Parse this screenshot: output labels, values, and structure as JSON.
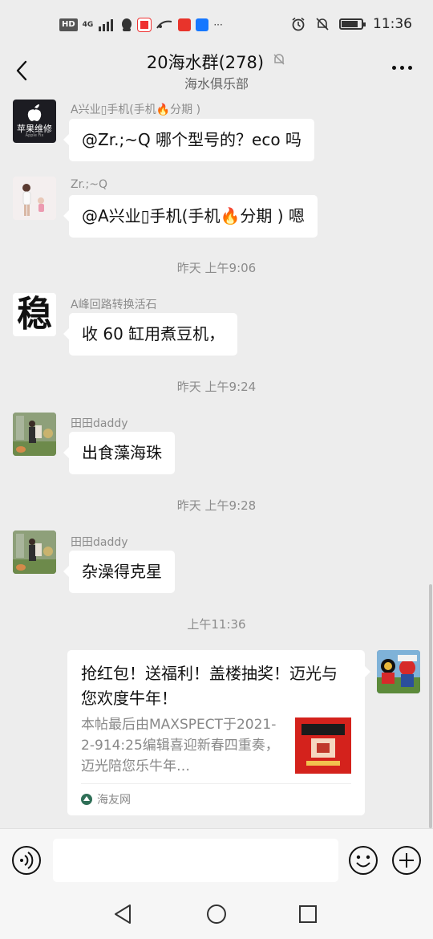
{
  "statusbar": {
    "hd": "HD",
    "network": "4G",
    "more": "···",
    "time": "11:36"
  },
  "header": {
    "title": "20海水群(278)",
    "subtitle": "海水俱乐部"
  },
  "messages": [
    {
      "sender": "A兴业▯手机(手机🔥分期 )",
      "text": "@Zr.;~Q  哪个型号的？eco 吗"
    },
    {
      "sender": "Zr.;~Q",
      "text": "@A兴业▯手机(手机🔥分期 ) 嗯"
    },
    {
      "sender": "A峰回路转换活石",
      "text": "收 60 缸用煮豆机，"
    },
    {
      "sender": "田田daddy",
      "text": "出食藻海珠"
    },
    {
      "sender": "田田daddy",
      "text": "杂澡得克星"
    }
  ],
  "timestamps": [
    "昨天 上午9:06",
    "昨天 上午9:24",
    "昨天 上午9:28",
    "上午11:36"
  ],
  "avatars": {
    "apple_repair_line1": "苹果维修",
    "apple_repair_line2": "Apple Fix",
    "wen_char": "稳"
  },
  "card": {
    "title": "抢红包！送福利！盖楼抽奖！迈光与您欢度牛年！",
    "desc": "本帖最后由MAXSPECT于2021-2-914:25编辑喜迎新春四重奏，迈光陪您乐牛年…",
    "source": "海友网"
  },
  "input": {
    "placeholder": ""
  }
}
